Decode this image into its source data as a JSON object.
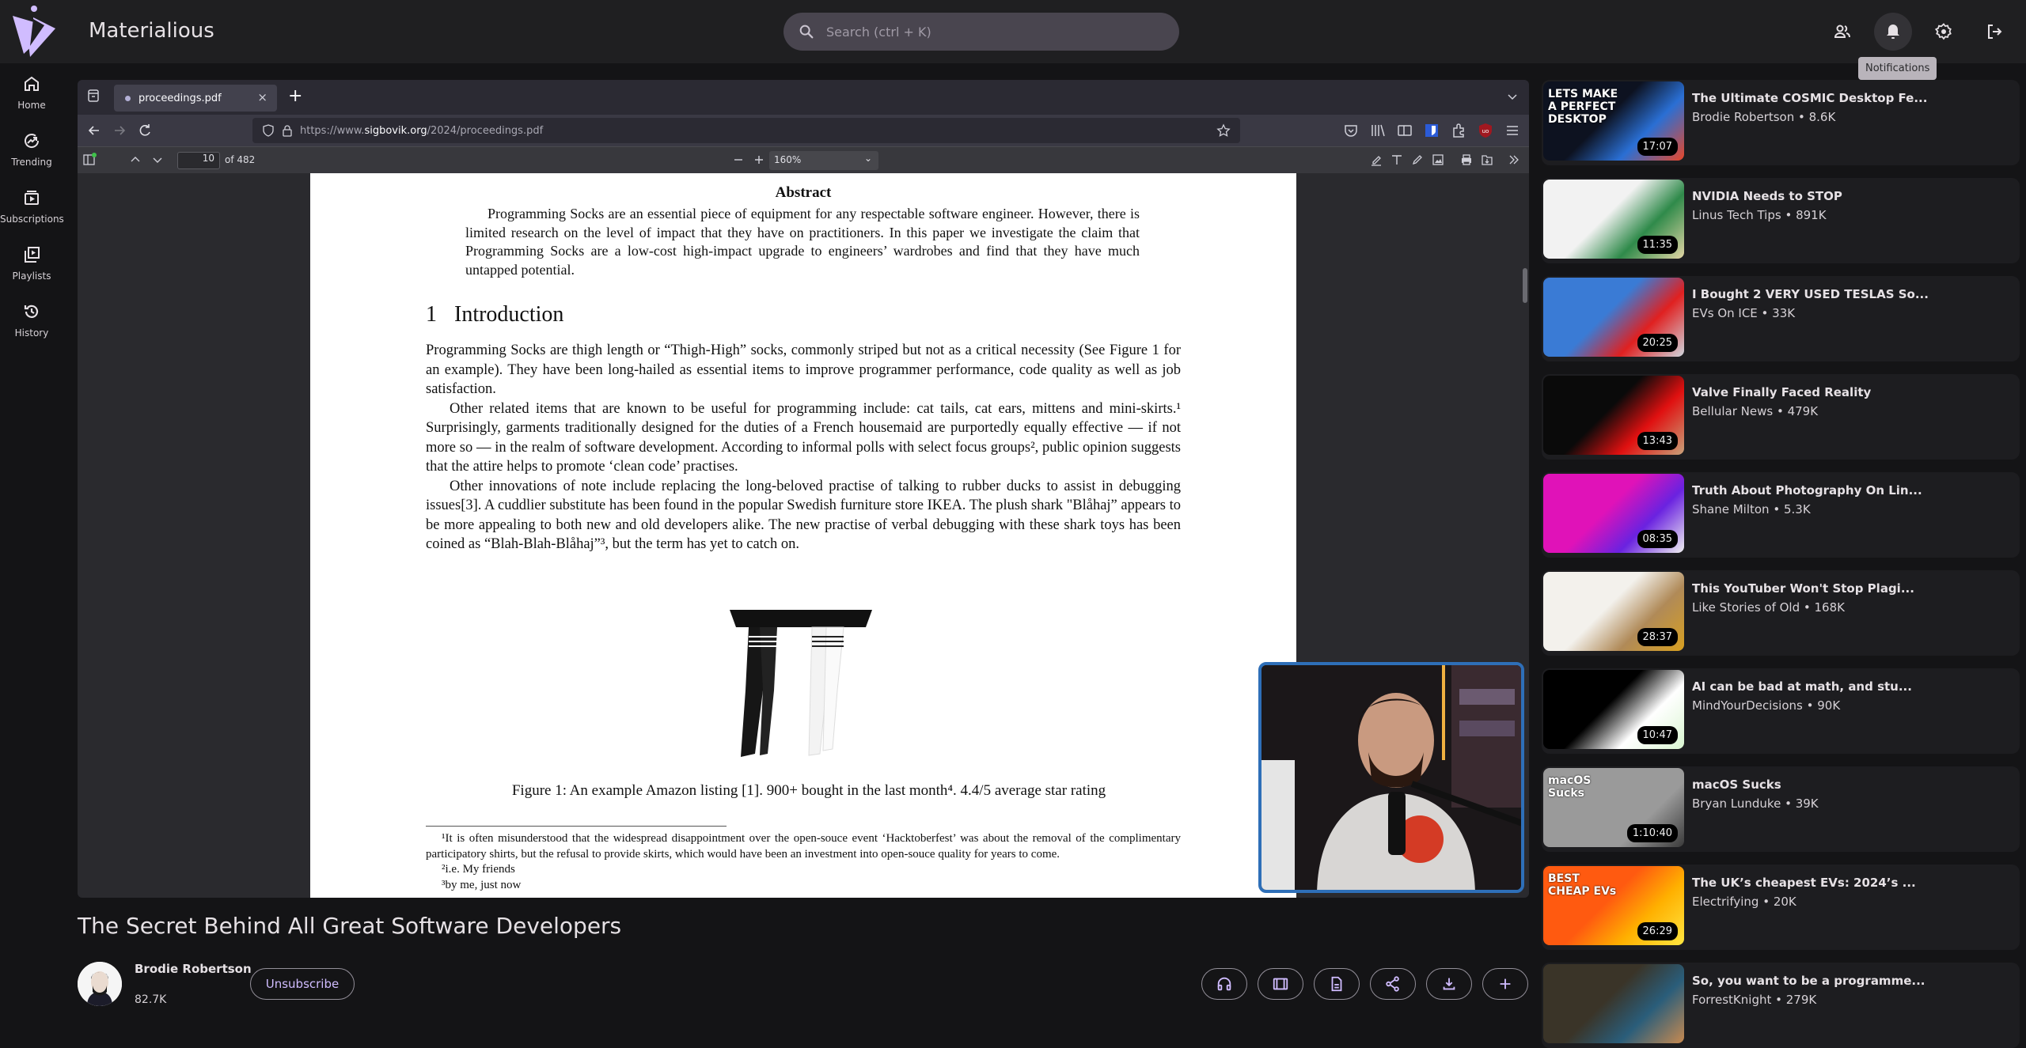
{
  "app": {
    "title": "Materialious",
    "search_placeholder": "Search (ctrl + K)",
    "top_actions": [
      "subscriptions-manage",
      "notifications",
      "settings",
      "logout"
    ],
    "tooltip": "Notifications",
    "accent": "#d0bcff"
  },
  "sidebar": {
    "items": [
      {
        "label": "Home",
        "icon": "home-icon"
      },
      {
        "label": "Trending",
        "icon": "trending-icon"
      },
      {
        "label": "Subscriptions",
        "icon": "subscriptions-icon"
      },
      {
        "label": "Playlists",
        "icon": "playlists-icon"
      },
      {
        "label": "History",
        "icon": "history-icon"
      }
    ]
  },
  "video_frame": {
    "browser": {
      "tab_title": "proceedings.pdf",
      "url_prefix": "https://www.",
      "url_domain": "sigbovik.org",
      "url_path": "/2024/proceedings.pdf",
      "pdf": {
        "page_number": "10",
        "page_total": "of 482",
        "zoom": "160%"
      }
    },
    "document": {
      "abstract_title": "Abstract",
      "abstract_body": "Programming Socks are an essential piece of equipment for any respectable software engineer. However, there is limited research on the level of impact that they have on practitioners. In this paper we investigate the claim that Programming Socks are a low-cost high-impact upgrade to engineers’ wardrobes and find that they have much untapped potential.",
      "section_number": "1",
      "section_title": "Introduction",
      "paragraphs": [
        "Programming Socks are thigh length or “Thigh-High” socks, commonly striped but not as a critical necessity (See Figure 1 for an example). They have been long-hailed as essential items to improve programmer performance, code quality as well as job satisfaction.",
        "Other related items that are known to be useful for programming include: cat tails, cat ears, mittens and mini-skirts.¹ Surprisingly, garments traditionally designed for the duties of a French housemaid are purportedly equally effective — if not more so — in the realm of software development. According to informal polls with select focus groups², public opinion suggests that the attire helps to promote ‘clean code’ practises.",
        "Other innovations of note include replacing the long-beloved practise of talking to rubber ducks to assist in debugging issues[3]. A cuddlier substitute has been found in the popular Swedish furniture store IKEA. The plush shark \"Blåhaj” appears to be more appealing to both new and old developers alike. The new practise of verbal debugging with these shark toys has been coined as “Blah-Blah-Blåhaj”³, but the term has yet to catch on."
      ],
      "figure_caption": "Figure 1: An example Amazon listing [1]. 900+ bought in the last month⁴. 4.4/5 average star rating",
      "footnotes": [
        "¹It is often misunderstood that the widespread disappointment over the open-souce event ‘Hacktoberfest’ was about the removal of the complimentary participatory shirts, but the refusal to provide skirts, which would have been an investment into open-souce quality for years to come.",
        "²i.e. My friends",
        "³by me, just now"
      ]
    }
  },
  "video": {
    "title": "The Secret Behind All Great Software Developers",
    "channel": "Brodie Robertson",
    "subscribers": "82.7K",
    "unsubscribe_label": "Unsubscribe",
    "actions": [
      "audio-only",
      "theater-mode",
      "transcript",
      "share",
      "download",
      "add-to-playlist"
    ]
  },
  "related": [
    {
      "title": "The Ultimate COSMIC Desktop Fe...",
      "channel": "Brodie Robertson",
      "views": "8.6K",
      "duration": "17:07",
      "thumb": [
        "#0d1220",
        "#2a6fd4",
        "#e8472a"
      ]
    },
    {
      "title": "NVIDIA Needs to STOP",
      "channel": "Linus Tech Tips",
      "views": "891K",
      "duration": "11:35",
      "thumb": [
        "#f2f2f2",
        "#2f8a4a",
        "#e3d6a5"
      ]
    },
    {
      "title": "I Bought 2 VERY USED TESLAS So...",
      "channel": "EVs On ICE",
      "views": "33K",
      "duration": "20:25",
      "thumb": [
        "#3a7bd5",
        "#e02020",
        "#cfd6de"
      ]
    },
    {
      "title": "Valve Finally Faced Reality",
      "channel": "Bellular News",
      "views": "479K",
      "duration": "13:43",
      "thumb": [
        "#0a0a0a",
        "#e01010",
        "#c9a27a"
      ]
    },
    {
      "title": "Truth About Photography On Lin...",
      "channel": "Shane Milton",
      "views": "5.3K",
      "duration": "08:35",
      "thumb": [
        "#e012b8",
        "#6a22e0",
        "#f0f0f0"
      ]
    },
    {
      "title": "This YouTuber Won't Stop Plagi...",
      "channel": "Like Stories of Old",
      "views": "168K",
      "duration": "28:37",
      "thumb": [
        "#f3f1ec",
        "#b08a58",
        "#d8a020"
      ]
    },
    {
      "title": "AI can be bad at math, and stu...",
      "channel": "MindYourDecisions",
      "views": "90K",
      "duration": "10:47",
      "thumb": [
        "#000000",
        "#ffffff",
        "#d9f5d0"
      ]
    },
    {
      "title": "macOS Sucks",
      "channel": "Bryan Lunduke",
      "views": "39K",
      "duration": "1:10:40",
      "thumb": [
        "#9a9a9a",
        "#9a9a9a",
        "#3a3a3a"
      ]
    },
    {
      "title": "The UK’s cheapest EVs: 2024’s ...",
      "channel": "Electrifying",
      "views": "20K",
      "duration": "26:29",
      "thumb": [
        "#ff5a10",
        "#ffb000",
        "#ffe640"
      ]
    },
    {
      "title": "So, you want to be a programme...",
      "channel": "ForrestKnight",
      "views": "279K",
      "duration": "",
      "thumb": [
        "#3a3428",
        "#2a5d7a",
        "#c88a50"
      ]
    }
  ],
  "related_thumb_text": {
    "0": "LETS MAKE A PERFECT DESKTOP",
    "7": "macOS Sucks",
    "8": "BEST CHEAP EVs"
  }
}
